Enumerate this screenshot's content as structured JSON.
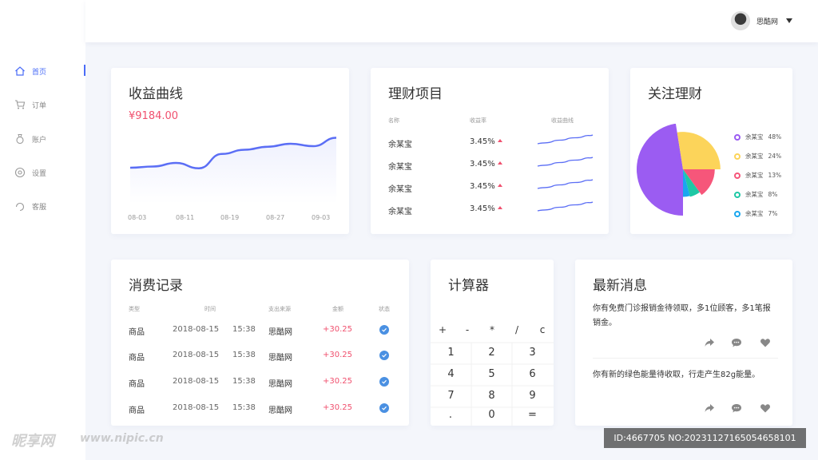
{
  "sidebar": {
    "items": [
      {
        "label": "首页",
        "icon": "home-icon",
        "active": true
      },
      {
        "label": "订单",
        "icon": "cart-icon",
        "active": false
      },
      {
        "label": "账户",
        "icon": "account-icon",
        "active": false
      },
      {
        "label": "设置",
        "icon": "settings-icon",
        "active": false
      },
      {
        "label": "客服",
        "icon": "service-icon",
        "active": false
      }
    ]
  },
  "header": {
    "username": "思酷网"
  },
  "income": {
    "title": "收益曲线",
    "amount": "¥9184.00",
    "x_ticks": [
      "08-03",
      "08-11",
      "08-19",
      "08-27",
      "09-03"
    ]
  },
  "chart_data": {
    "type": "area",
    "title": "收益曲线",
    "categories": [
      "08-03",
      "08-11",
      "08-19",
      "08-27",
      "09-03"
    ],
    "values": [
      210,
      212,
      218,
      209,
      233,
      240,
      245,
      250,
      246,
      260
    ],
    "ylim": [
      150,
      270
    ],
    "grid": false,
    "line_color": "#5b6ef5"
  },
  "finance": {
    "title": "理财项目",
    "headers": {
      "name": "名称",
      "rate": "收益率",
      "curve": "收益曲线"
    },
    "rows": [
      {
        "name": "余某宝",
        "rate": "3.45%"
      },
      {
        "name": "余某宝",
        "rate": "3.45%"
      },
      {
        "name": "余某宝",
        "rate": "3.45%"
      },
      {
        "name": "余某宝",
        "rate": "3.45%"
      }
    ]
  },
  "follow": {
    "title": "关注理财",
    "items": [
      {
        "name": "余某宝",
        "pct": "48%",
        "value": 48,
        "color": "#9b5cf2"
      },
      {
        "name": "余某宝",
        "pct": "24%",
        "value": 24,
        "color": "#fcd45a"
      },
      {
        "name": "余某宝",
        "pct": "13%",
        "value": 13,
        "color": "#f6567a"
      },
      {
        "name": "余某宝",
        "pct": "8%",
        "value": 8,
        "color": "#1ec8a5"
      },
      {
        "name": "余某宝",
        "pct": "7%",
        "value": 7,
        "color": "#1aa7ef"
      }
    ]
  },
  "records": {
    "title": "消费记录",
    "headers": {
      "type": "类型",
      "time": "时间",
      "source": "支出来源",
      "amount": "金额",
      "status": "状态"
    },
    "rows": [
      {
        "type": "商品",
        "date": "2018-08-15",
        "time": "15:38",
        "source": "思酷网",
        "amount": "+30.25"
      },
      {
        "type": "商品",
        "date": "2018-08-15",
        "time": "15:38",
        "source": "思酷网",
        "amount": "+30.25"
      },
      {
        "type": "商品",
        "date": "2018-08-15",
        "time": "15:38",
        "source": "思酷网",
        "amount": "+30.25"
      },
      {
        "type": "商品",
        "date": "2018-08-15",
        "time": "15:38",
        "source": "思酷网",
        "amount": "+30.25"
      }
    ]
  },
  "calculator": {
    "title": "计算器",
    "keys": [
      "+",
      "-",
      "*",
      "/",
      "c",
      "1",
      "2",
      "3",
      "4",
      "5",
      "6",
      "7",
      "8",
      "9",
      ".",
      "0",
      "="
    ]
  },
  "news": {
    "title": "最新消息",
    "items": [
      {
        "text": "你有免费门诊报销金待领取，多1位顾客，多1笔报销金。"
      },
      {
        "text": "你有新的绿色能量待收取，行走产生82g能量。"
      }
    ]
  },
  "watermark": {
    "logo": "昵享网",
    "site": "www.nipic.cn",
    "id": "ID:4667705 NO:20231127165054658101"
  }
}
